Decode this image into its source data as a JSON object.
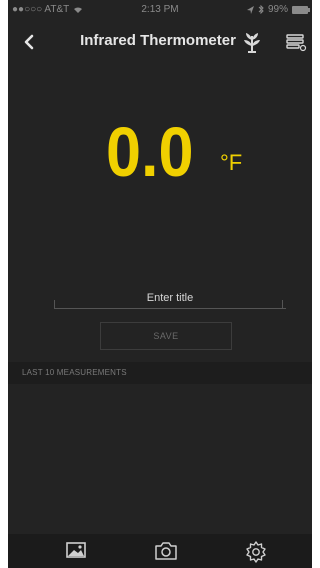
{
  "status_bar": {
    "carrier": "●●○○○ AT&T",
    "time": "2:13 PM",
    "battery": "99%"
  },
  "nav": {
    "title": "Infrared Thermometer",
    "icons": [
      "back-chevron-icon",
      "plant-icon",
      "list-settings-icon"
    ]
  },
  "reading": {
    "value": "0.0",
    "unit": "°F"
  },
  "form": {
    "title_placeholder": "Enter title",
    "save_label": "SAVE"
  },
  "measurements": {
    "header": "LAST 10 MEASUREMENTS",
    "items": []
  },
  "tabs": [
    "gallery-icon",
    "camera-icon",
    "settings-gear-icon"
  ],
  "colors": {
    "accent": "#f0d000",
    "background": "#232323"
  }
}
